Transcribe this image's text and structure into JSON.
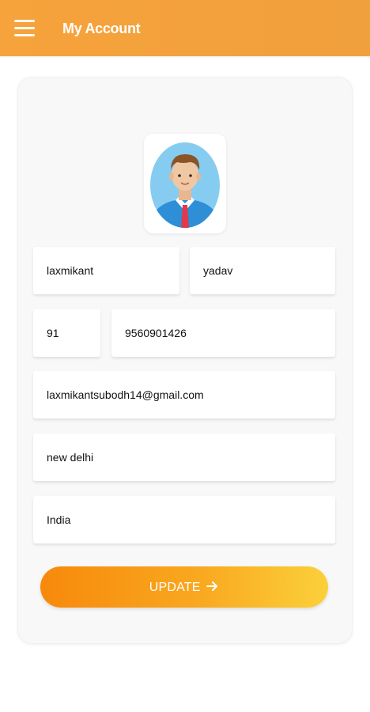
{
  "header": {
    "title": "My Account",
    "menu_icon": "hamburger-menu-icon",
    "background": "#f3a13d"
  },
  "profile": {
    "avatar_icon": "user-avatar-icon",
    "first_name": "laxmikant",
    "last_name": "yadav",
    "country_code": "91",
    "phone": "9560901426",
    "email": "laxmikantsubodh14@gmail.com",
    "city": "new delhi",
    "country": "India"
  },
  "actions": {
    "update_label": "UPDATE",
    "update_icon": "arrow-right-icon"
  },
  "colors": {
    "accent": "#f3a13d",
    "button_gradient_start": "#f7890b",
    "button_gradient_end": "#fbd03a"
  }
}
